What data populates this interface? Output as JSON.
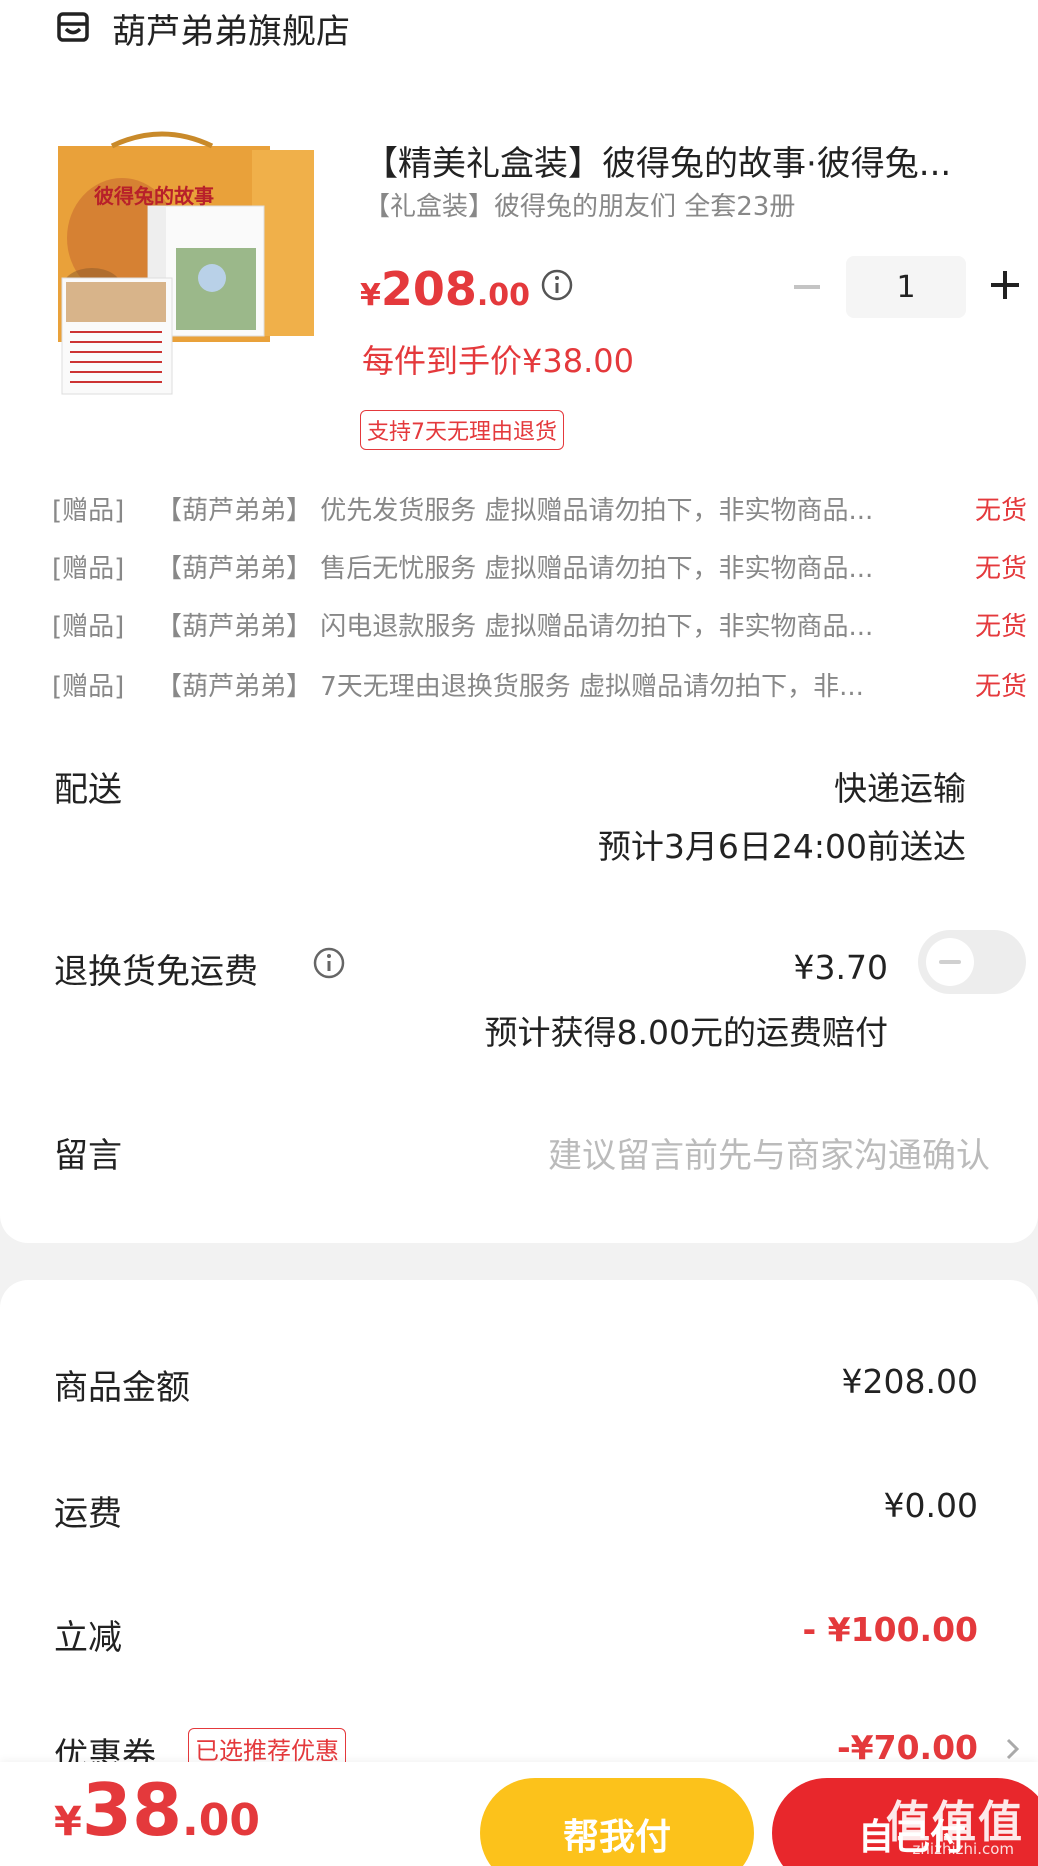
{
  "shop": {
    "name": "葫芦弟弟旗舰店",
    "icon": "store-icon"
  },
  "product": {
    "title": "【精美礼盒装】彼得兔的故事·彼得兔...",
    "subtitle": "【礼盒装】彼得兔的朋友们 全套23册",
    "price_currency": "¥",
    "price_int": "208",
    "price_dec": ".00",
    "quantity": "1",
    "unit_price_label": "每件到手价¥38.00",
    "return_badge": "支持7天无理由退货",
    "image_text": "彼得兔的故事"
  },
  "gifts": [
    {
      "tag": "[赠品]",
      "text": "【葫芦弟弟】 优先发货服务 虚拟赠品请勿拍下，非实物商品...",
      "status": "无货"
    },
    {
      "tag": "[赠品]",
      "text": "【葫芦弟弟】 售后无忧服务 虚拟赠品请勿拍下，非实物商品...",
      "status": "无货"
    },
    {
      "tag": "[赠品]",
      "text": "【葫芦弟弟】 闪电退款服务 虚拟赠品请勿拍下，非实物商品...",
      "status": "无货"
    },
    {
      "tag": "[赠品]",
      "text": "【葫芦弟弟】 7天无理由退换货服务 虚拟赠品请勿拍下，非...",
      "status": "无货"
    }
  ],
  "delivery": {
    "label": "配送",
    "method": "快递运输",
    "eta": "预计3月6日24:00前送达"
  },
  "insurance": {
    "label": "退换货免运费",
    "price": "¥3.70",
    "note": "预计获得8.00元的运费赔付",
    "enabled": false
  },
  "message": {
    "label": "留言",
    "placeholder": "建议留言前先与商家沟通确认"
  },
  "summary": {
    "goods_label": "商品金额",
    "goods_value": "¥208.00",
    "shipping_label": "运费",
    "shipping_value": "¥0.00",
    "discount_label": "立减",
    "discount_value": "- ¥100.00",
    "coupon_label": "优惠券",
    "coupon_badge": "已选推荐优惠",
    "coupon_value": "-¥70.00"
  },
  "footer": {
    "total_currency": "¥",
    "total_int": "38",
    "total_dec": ".00",
    "help_pay": "帮我付",
    "self_pay": "自己付",
    "watermark": "值值值",
    "watermark_sub": "zhizhizhi.com"
  },
  "colors": {
    "accent": "#e4393c",
    "help_button": "#fcc21b",
    "pay_button": "#e8272c"
  }
}
